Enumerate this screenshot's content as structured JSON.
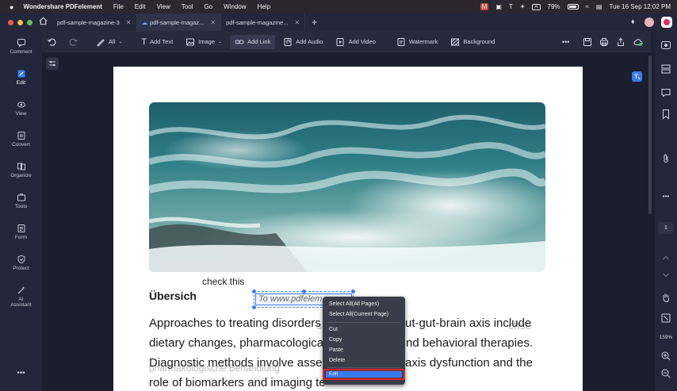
{
  "menubar": {
    "app_name": "Wondershare PDFelement",
    "items": [
      "File",
      "Edit",
      "View",
      "Tool",
      "Go",
      "Window",
      "Help"
    ],
    "battery": "79%",
    "datetime": "Tue 16 Sep  12:02 PM"
  },
  "tabs": [
    {
      "label": "pdf-sample-magazine-3"
    },
    {
      "label": "pdf-sample-magaz..."
    },
    {
      "label": "pdf-sample-magazine..."
    }
  ],
  "toolbar": {
    "all_label": "All",
    "add_text": "Add Text",
    "image": "Image",
    "add_link": "Add Link",
    "add_audio": "Add Audio",
    "add_video": "Add Video",
    "watermark": "Watermark",
    "background": "Background"
  },
  "sidebar": {
    "items": [
      {
        "label": "Comment",
        "icon": "comment-icon"
      },
      {
        "label": "Edit",
        "icon": "edit-icon"
      },
      {
        "label": "View",
        "icon": "eye-icon"
      },
      {
        "label": "Convert",
        "icon": "convert-icon"
      },
      {
        "label": "Organize",
        "icon": "organize-icon"
      },
      {
        "label": "Tools",
        "icon": "tools-icon"
      },
      {
        "label": "Form",
        "icon": "form-icon"
      },
      {
        "label": "Protect",
        "icon": "shield-icon"
      },
      {
        "label": "AI",
        "icon": "ai-icon"
      },
      {
        "label": "Assistant",
        "icon": "ai-icon"
      }
    ]
  },
  "rightbar": {
    "page_number": "1",
    "zoom": "159%"
  },
  "document": {
    "check_text": "check this",
    "heading": "Übersich",
    "link_text": "To www.pdfelem",
    "para_line1": "Approaches to treating disorders",
    "para_line1_end": "ut-gut-brain axis include",
    "para_line2": "dietary changes, pharmacologica",
    "para_line2_end": "nd behavioral therapies.",
    "para_line3": "Diagnostic methods involve asse",
    "para_line3_end": "axis dysfunction and the",
    "para_line4": "role of biomarkers and imaging te",
    "ghost_line1": "se",
    "ghost_line1_end": "chse",
    "ghost_line3": "pharmakologische Behandlung"
  },
  "context_menu": {
    "select_all_pages": "Select All(All Pages)",
    "select_all_current": "Select All(Current Page)",
    "cut": "Cut",
    "copy": "Copy",
    "paste": "Paste",
    "delete": "Delete",
    "edit": "Edit"
  },
  "colors": {
    "accent": "#3a7bf0",
    "highlight_border": "#e0232c"
  }
}
